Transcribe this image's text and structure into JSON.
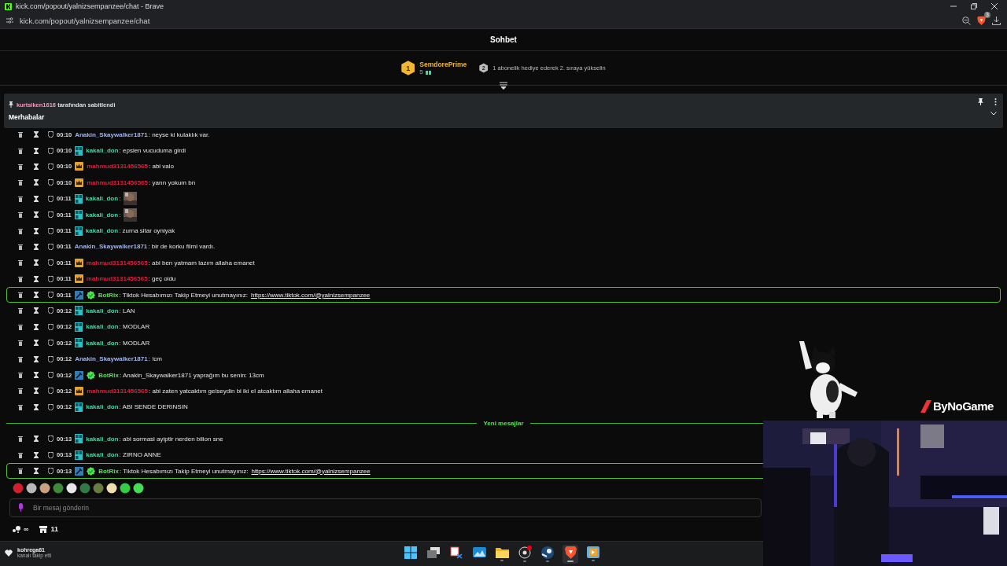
{
  "window": {
    "title": "kick.com/popout/yalnizsempanzee/chat - Brave",
    "url": "kick.com/popout/yalnizsempanzee/chat",
    "shield_count": "3"
  },
  "chat": {
    "title": "Sohbet",
    "leaderboard": {
      "rank": "1",
      "user": "SemdorePrime",
      "gifts": "5",
      "next_rank": "2",
      "hint": "1 abonelik hediye ederek 2. sıraya yükselin"
    },
    "pinned": {
      "by_user": "kurtsiken1616",
      "by_text": "tarafından sabitlendi",
      "message": "Merhabalar"
    },
    "messages": [
      {
        "kind": "message",
        "time": "00:10",
        "user": "Anakin_Skaywalker1871",
        "color": "#9fb4f0",
        "text": ": neyse ki kulaklık var.",
        "emote": false,
        "highlighted": false
      },
      {
        "kind": "message",
        "time": "00:10",
        "user": "kakali_don",
        "color": "#3fd9a6",
        "badges": [
          {
            "kind": "og"
          }
        ],
        "text": ": epsien vucuduma girdi",
        "emote": false,
        "highlighted": false
      },
      {
        "kind": "message",
        "time": "00:10",
        "user": "mahmud3131456565",
        "color": "#d8203c",
        "badges": [
          {
            "kind": "crown"
          }
        ],
        "text": ": abi valo",
        "emote": false,
        "highlighted": false
      },
      {
        "kind": "message",
        "time": "00:10",
        "user": "mahmud3131456565",
        "color": "#d8203c",
        "badges": [
          {
            "kind": "crown"
          }
        ],
        "text": ": yarın yokum bn",
        "emote": false,
        "highlighted": false
      },
      {
        "kind": "message",
        "time": "00:11",
        "user": "kakali_don",
        "color": "#3fd9a6",
        "badges": [
          {
            "kind": "og"
          }
        ],
        "text": ":",
        "emote": true,
        "highlighted": false
      },
      {
        "kind": "message",
        "time": "00:11",
        "user": "kakali_don",
        "color": "#3fd9a6",
        "badges": [
          {
            "kind": "og"
          }
        ],
        "text": ":",
        "emote": true,
        "highlighted": false
      },
      {
        "kind": "message",
        "time": "00:11",
        "user": "kakali_don",
        "color": "#3fd9a6",
        "badges": [
          {
            "kind": "og"
          }
        ],
        "text": ": zurna sitar oyniyak",
        "emote": false,
        "highlighted": false
      },
      {
        "kind": "message",
        "time": "00:11",
        "user": "Anakin_Skaywalker1871",
        "color": "#9fb4f0",
        "text": ": bir de korku filmi vardı.",
        "emote": false,
        "highlighted": false
      },
      {
        "kind": "message",
        "time": "00:11",
        "user": "mahmud3131456565",
        "color": "#d8203c",
        "badges": [
          {
            "kind": "crown"
          }
        ],
        "text": ": abi ben yatmam lazım allaha emanet",
        "emote": false,
        "highlighted": false
      },
      {
        "kind": "message",
        "time": "00:11",
        "user": "mahmud3131456565",
        "color": "#d8203c",
        "badges": [
          {
            "kind": "crown"
          }
        ],
        "text": ": geç oldu",
        "emote": false,
        "highlighted": false
      },
      {
        "kind": "message",
        "time": "00:11",
        "user": "BotRix",
        "color": "#53e04f",
        "badges": [
          {
            "kind": "mod"
          },
          {
            "kind": "verified"
          }
        ],
        "text": ": Tiktok Hesabımızı Takip Etmeyi unutmayınız:",
        "link": "https://www.tiktok.com/@yalnizsempanzee",
        "emote": false,
        "highlighted": true
      },
      {
        "kind": "message",
        "time": "00:12",
        "user": "kakali_don",
        "color": "#3fd9a6",
        "badges": [
          {
            "kind": "og"
          }
        ],
        "text": ": LAN",
        "emote": false,
        "highlighted": false
      },
      {
        "kind": "message",
        "time": "00:12",
        "user": "kakali_don",
        "color": "#3fd9a6",
        "badges": [
          {
            "kind": "og"
          }
        ],
        "text": ": MODLAR",
        "emote": false,
        "highlighted": false
      },
      {
        "kind": "message",
        "time": "00:12",
        "user": "kakali_don",
        "color": "#3fd9a6",
        "badges": [
          {
            "kind": "og"
          }
        ],
        "text": ": MODLAR",
        "emote": false,
        "highlighted": false
      },
      {
        "kind": "message",
        "time": "00:12",
        "user": "Anakin_Skaywalker1871",
        "color": "#9fb4f0",
        "text": ": !cm",
        "emote": false,
        "highlighted": false
      },
      {
        "kind": "message",
        "time": "00:12",
        "user": "BotRix",
        "color": "#53e04f",
        "badges": [
          {
            "kind": "mod"
          },
          {
            "kind": "verified"
          }
        ],
        "text": ": Anakin_Skaywalker1871 yaprağım bu senin: 13cm",
        "emote": false,
        "highlighted": false
      },
      {
        "kind": "message",
        "time": "00:12",
        "user": "mahmud3131456565",
        "color": "#d8203c",
        "badges": [
          {
            "kind": "crown"
          }
        ],
        "text": ": abi zaten yatcaktım gelseydin bi iki el atcaktım allaha emanet",
        "emote": false,
        "highlighted": false
      },
      {
        "kind": "message",
        "time": "00:12",
        "user": "kakali_don",
        "color": "#3fd9a6",
        "badges": [
          {
            "kind": "og"
          }
        ],
        "text": ": ABI SENDE DERINSIN",
        "emote": false,
        "highlighted": false
      },
      {
        "kind": "divider",
        "text": "Yeni mesajlar"
      },
      {
        "kind": "message",
        "time": "00:13",
        "user": "kakali_don",
        "color": "#3fd9a6",
        "badges": [
          {
            "kind": "og"
          }
        ],
        "text": ": abi sormasi ayiptir nerden bilion sne",
        "emote": false,
        "highlighted": false
      },
      {
        "kind": "message",
        "time": "00:13",
        "user": "kakali_don",
        "color": "#3fd9a6",
        "badges": [
          {
            "kind": "og"
          }
        ],
        "text": ": ZIRNO ANNE",
        "emote": false,
        "highlighted": false
      },
      {
        "kind": "message",
        "time": "00:13",
        "user": "BotRix",
        "color": "#53e04f",
        "badges": [
          {
            "kind": "mod"
          },
          {
            "kind": "verified"
          }
        ],
        "text": ": Tiktok Hesabımızı Takip Etmeyi unutmayınız:",
        "link": "https://www.tiktok.com/@yalnizsempanzee",
        "emote": false,
        "highlighted": true
      }
    ],
    "emotes": [
      {
        "color": "#d0202c"
      },
      {
        "color": "#b8b8b8"
      },
      {
        "color": "#c9a080"
      },
      {
        "color": "#3e8a3a"
      },
      {
        "color": "#e8e8e8"
      },
      {
        "color": "#2f7a45"
      },
      {
        "color": "#6a7a40"
      },
      {
        "color": "#f0e0b0"
      },
      {
        "color": "#33cc44"
      },
      {
        "color": "#44dd55"
      }
    ],
    "input": {
      "placeholder": "Bir mesaj gönderin"
    },
    "points": "∞",
    "store_count": "11"
  },
  "alert": {
    "user": "kohrega61",
    "text": "kanalı takip etti"
  },
  "overlay": {
    "logo_text": "ByNoGame"
  },
  "taskbar": [
    {
      "kind": "start",
      "selected": false,
      "running": false
    },
    {
      "kind": "taskview",
      "selected": false,
      "running": false
    },
    {
      "kind": "snip",
      "selected": false,
      "running": false
    },
    {
      "kind": "photos",
      "selected": false,
      "running": false
    },
    {
      "kind": "folder",
      "selected": false,
      "running": true
    },
    {
      "kind": "obs",
      "selected": false,
      "running": true
    },
    {
      "kind": "steam",
      "selected": false,
      "running": true
    },
    {
      "kind": "brave",
      "selected": true,
      "running": true
    },
    {
      "kind": "media",
      "selected": false,
      "running": true
    }
  ]
}
